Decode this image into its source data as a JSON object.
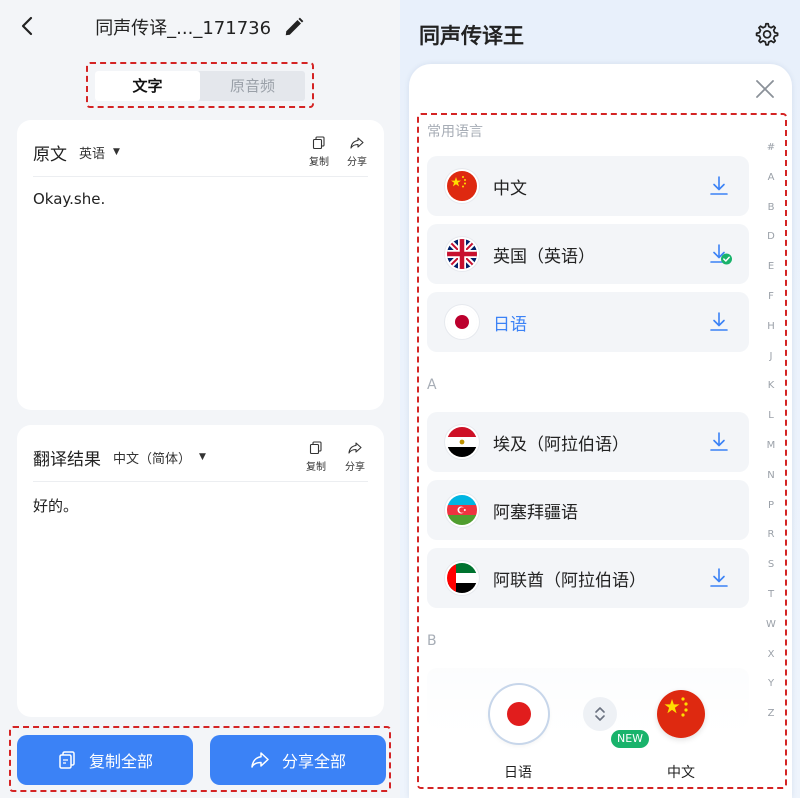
{
  "left": {
    "title": "同声传译_..._171736",
    "tabs": {
      "text": "文字",
      "audio": "原音频"
    },
    "source_card": {
      "title": "原文",
      "language": "英语",
      "copy": "复制",
      "share": "分享",
      "content": "Okay.she."
    },
    "result_card": {
      "title": "翻译结果",
      "language": "中文（简体）",
      "copy": "复制",
      "share": "分享",
      "content": "好的。"
    },
    "bottom": {
      "copy_all": "复制全部",
      "share_all": "分享全部"
    }
  },
  "right": {
    "app_title": "同声传译王",
    "sections": {
      "common": "常用语言",
      "a": "A",
      "b": "B"
    },
    "languages": [
      {
        "name": "中文",
        "flag": "china",
        "status": "download"
      },
      {
        "name": "英国（英语）",
        "flag": "uk",
        "status": "downloaded"
      },
      {
        "name": "日语",
        "flag": "japan",
        "status": "download",
        "selected": true
      },
      {
        "name": "埃及（阿拉伯语）",
        "flag": "egypt",
        "status": "download"
      },
      {
        "name": "阿塞拜疆语",
        "flag": "azerbaijan",
        "status": "none"
      },
      {
        "name": "阿联酋（阿拉伯语）",
        "flag": "uae",
        "status": "download"
      }
    ],
    "index_letters": [
      "#",
      "A",
      "B",
      "D",
      "E",
      "F",
      "H",
      "J",
      "K",
      "L",
      "M",
      "N",
      "P",
      "R",
      "S",
      "T",
      "W",
      "X",
      "Y",
      "Z"
    ],
    "bottom": {
      "left_lang": "日语",
      "right_lang": "中文",
      "new_badge": "NEW"
    }
  },
  "colors": {
    "accent": "#3b82f6",
    "highlight_border": "#d42424",
    "new_badge": "#19b36b"
  }
}
